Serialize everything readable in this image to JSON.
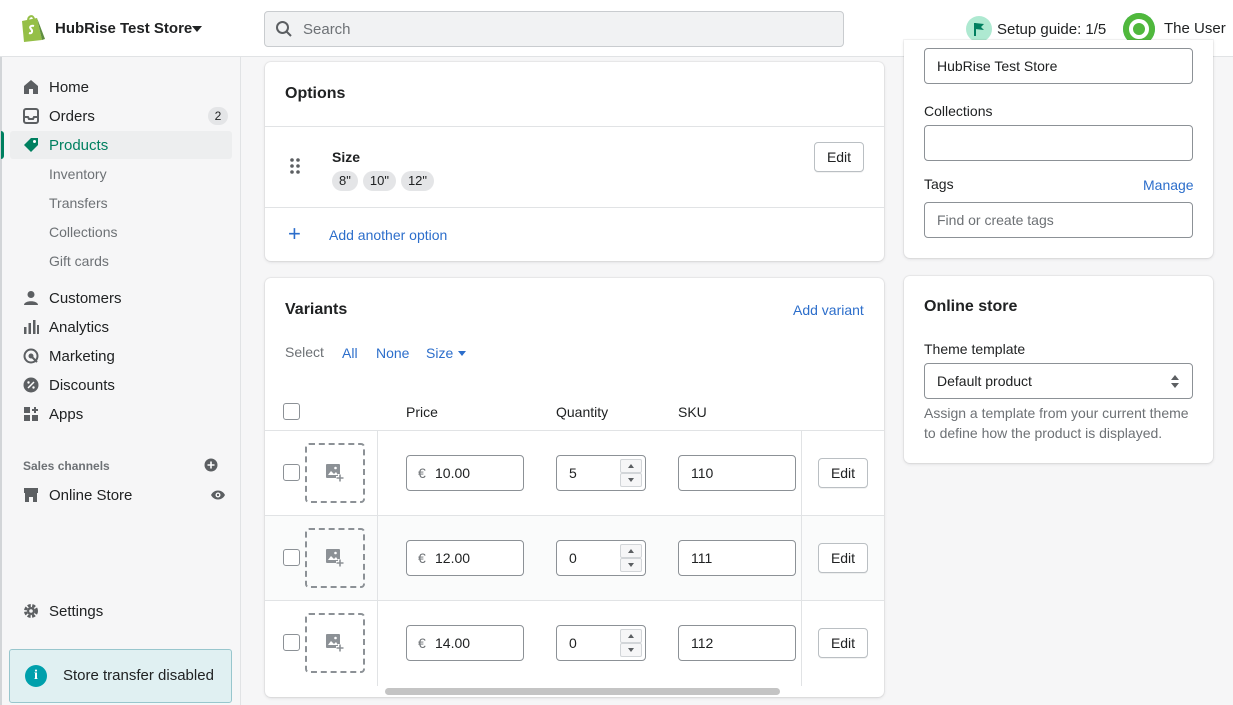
{
  "topbar": {
    "store_name": "HubRise Test Store",
    "search_placeholder": "Search",
    "setup_guide": "Setup guide: 1/5",
    "user_name": "The User"
  },
  "sidebar": {
    "home": "Home",
    "orders": "Orders",
    "orders_badge": "2",
    "products": "Products",
    "inventory": "Inventory",
    "transfers": "Transfers",
    "collections": "Collections",
    "gift_cards": "Gift cards",
    "customers": "Customers",
    "analytics": "Analytics",
    "marketing": "Marketing",
    "discounts": "Discounts",
    "apps": "Apps",
    "sales_channels": "Sales channels",
    "online_store": "Online Store",
    "settings": "Settings",
    "transfer_banner": "Store transfer disabled",
    "accent_color": "#008060"
  },
  "options": {
    "title": "Options",
    "option_name": "Size",
    "values": [
      "8\"",
      "10\"",
      "12\""
    ],
    "edit_label": "Edit",
    "add_label": "Add another option"
  },
  "variants": {
    "title": "Variants",
    "add_label": "Add variant",
    "select_label": "Select",
    "select_all": "All",
    "select_none": "None",
    "select_size": "Size",
    "columns": {
      "price": "Price",
      "quantity": "Quantity",
      "sku": "SKU"
    },
    "currency": "€",
    "edit_label": "Edit",
    "rows": [
      {
        "price": "10.00",
        "quantity": "5",
        "sku": "110"
      },
      {
        "price": "12.00",
        "quantity": "0",
        "sku": "111"
      },
      {
        "price": "14.00",
        "quantity": "0",
        "sku": "112"
      }
    ]
  },
  "organization": {
    "vendor_value": "HubRise Test Store",
    "collections_label": "Collections",
    "tags_label": "Tags",
    "tags_manage": "Manage",
    "tags_placeholder": "Find or create tags"
  },
  "online_store_card": {
    "title": "Online store",
    "theme_label": "Theme template",
    "theme_value": "Default product",
    "help": "Assign a template from your current theme to define how the product is displayed."
  },
  "colors": {
    "link": "#2c6ecb",
    "brand": "#008060"
  }
}
